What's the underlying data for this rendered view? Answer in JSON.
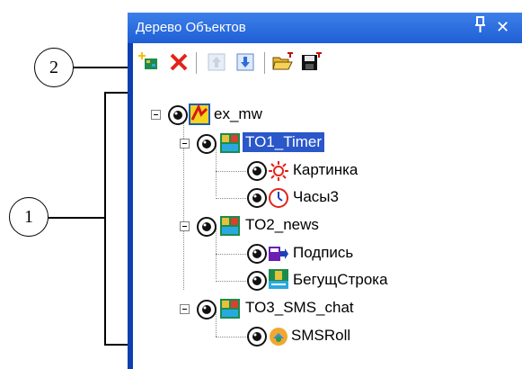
{
  "callouts": {
    "one": "1",
    "two": "2"
  },
  "panel": {
    "title": "Дерево Объектов",
    "pin_glyph": "ᵖ",
    "close_glyph": "✕"
  },
  "toolbar": {
    "buttons": [
      {
        "name": "add-object-icon"
      },
      {
        "name": "delete-icon"
      },
      {
        "name": "move-up-icon"
      },
      {
        "name": "move-down-icon"
      },
      {
        "name": "open-folder-icon"
      },
      {
        "name": "save-icon"
      }
    ]
  },
  "tree": {
    "root": "ex_mw",
    "groups": [
      {
        "label": "TO1_Timer",
        "children": [
          "Картинка",
          "Часы3"
        ]
      },
      {
        "label": "TO2_news",
        "children": [
          "Подпись",
          "БегущСтрока"
        ]
      },
      {
        "label": "TO3_SMS_chat",
        "children": [
          "SMSRoll"
        ]
      }
    ]
  },
  "colors": {
    "titlebar": "#2a6ae0",
    "selection": "#2a57c9"
  }
}
